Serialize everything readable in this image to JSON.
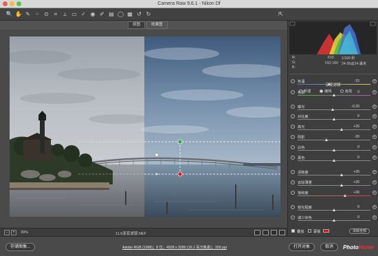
{
  "window": {
    "title": "Camera Raw 9.6.1 - Nikon Df",
    "close_color": "#ee5c52",
    "minimize_color": "#f5bd3c",
    "zoom_color": "#5ec248"
  },
  "toolbar": {
    "tools": [
      "zoom-icon",
      "hand-icon",
      "white-balance-icon",
      "color-sampler-icon",
      "target-adjust-icon",
      "crop-icon",
      "straighten-icon",
      "transform-icon",
      "spot-removal-icon",
      "red-eye-icon",
      "adjustment-brush-icon",
      "graduated-filter-icon",
      "radial-filter-icon",
      "preferences-icon",
      "rotate-left-icon",
      "rotate-right-icon"
    ],
    "glyphs": [
      "🔍",
      "✋",
      "✎",
      "⁘",
      "⊙",
      "⌗",
      "⟂",
      "▭",
      "✓",
      "◉",
      "✐",
      "▤",
      "◯",
      "▦",
      "↺",
      "↻"
    ],
    "export_icon": "export-icon"
  },
  "before_after": {
    "before_label": "原图",
    "after_label": "效果图"
  },
  "status": {
    "zoom_minus": "-",
    "zoom_plus": "+",
    "zoom_level": "39%",
    "filename": "11.6渐变滤镜.NEF"
  },
  "histogram": {
    "rgb_r": "R:",
    "rgb_g": "G:",
    "rgb_b": "B:",
    "dash": "---",
    "aperture": "f/10",
    "shutter": "1/160 秒",
    "iso": "ISO 160",
    "lens": "24-35@24 毫米"
  },
  "panel": {
    "title": "渐变滤镜",
    "modes": [
      {
        "label": "新建",
        "selected": false
      },
      {
        "label": "编辑",
        "selected": true
      },
      {
        "label": "画笔",
        "selected": false
      }
    ],
    "sliders": [
      {
        "label": "色温",
        "value": "-15",
        "level": 0.43,
        "track": "temp"
      },
      {
        "label": "色调",
        "value": "0",
        "level": 0.5,
        "track": "tint"
      },
      {
        "label": "曝光",
        "value": "-0.20",
        "level": 0.48,
        "track": "gray"
      },
      {
        "label": "对比度",
        "value": "0",
        "level": 0.5,
        "track": "gray"
      },
      {
        "label": "高光",
        "value": "+20",
        "level": 0.6,
        "track": "gray"
      },
      {
        "label": "阴影",
        "value": "-20",
        "level": 0.4,
        "track": "gray"
      },
      {
        "label": "白色",
        "value": "0",
        "level": 0.5,
        "track": "gray"
      },
      {
        "label": "黑色",
        "value": "0",
        "level": 0.5,
        "track": "gray"
      },
      {
        "label": "清晰度",
        "value": "+20",
        "level": 0.6,
        "track": "gray"
      },
      {
        "label": "去除薄雾",
        "value": "+20",
        "level": 0.6,
        "track": "gray"
      },
      {
        "label": "饱和度",
        "value": "+30",
        "level": 0.65,
        "track": "sat"
      },
      {
        "label": "锐化程度",
        "value": "0",
        "level": 0.5,
        "track": "gray"
      },
      {
        "label": "减少杂色",
        "value": "0",
        "level": 0.5,
        "track": "gray"
      }
    ],
    "overlay_label": "叠加",
    "mask_label": "蒙版",
    "clear_all_label": "清除全部"
  },
  "bottom": {
    "save_label": "存储图像...",
    "workflow_link": "Adobe RGB (1998)；8 位；4928 x 3280 (16.2 百万像素)；300 ppi",
    "open_label": "打开对象",
    "cancel_label": "取消",
    "done_label": "完成"
  },
  "watermark": {
    "prefix": "Photo",
    "suffix": "Home"
  }
}
